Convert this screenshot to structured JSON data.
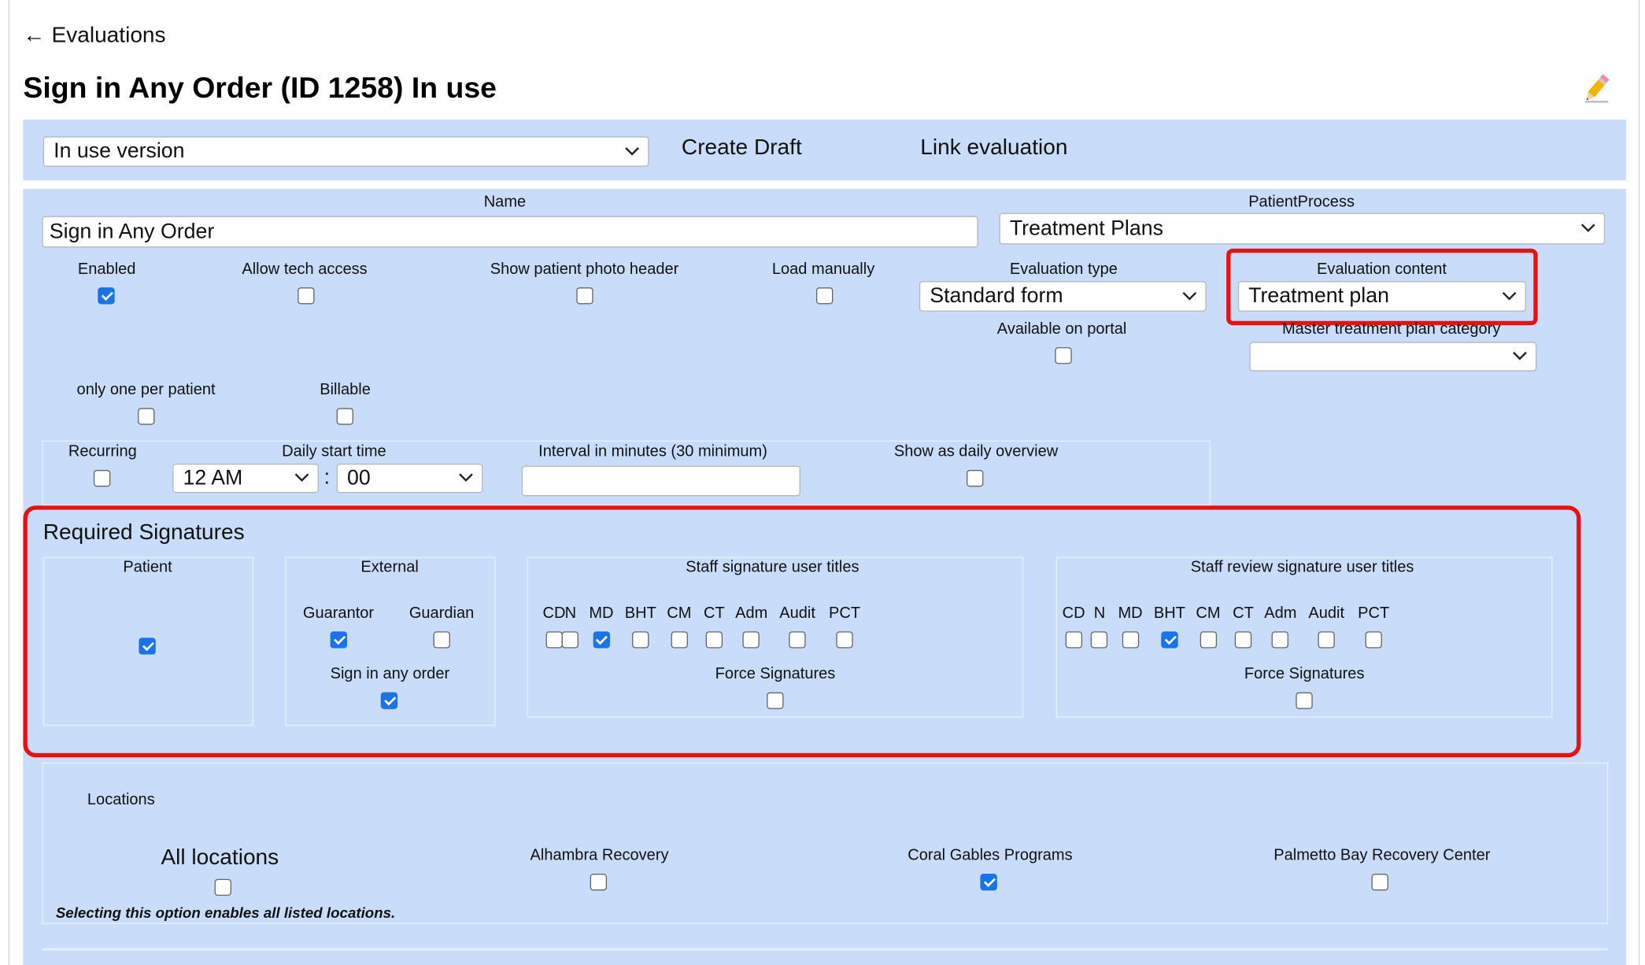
{
  "nav": {
    "back_arrow": "←",
    "back_label": "Evaluations"
  },
  "page": {
    "title": "Sign in Any Order (ID 1258) In use"
  },
  "topbar": {
    "version_select": "In use version",
    "create_draft": "Create Draft",
    "link_evaluation": "Link evaluation"
  },
  "fields": {
    "name_label": "Name",
    "name_value": "Sign in Any Order",
    "patient_process_label": "PatientProcess",
    "patient_process_value": "Treatment Plans",
    "enabled_label": "Enabled",
    "allow_tech_label": "Allow tech access",
    "photo_header_label": "Show patient photo header",
    "load_manually_label": "Load manually",
    "eval_type_label": "Evaluation type",
    "eval_type_value": "Standard form",
    "eval_content_label": "Evaluation content",
    "eval_content_value": "Treatment plan",
    "portal_label": "Available on portal",
    "master_category_label": "Master treatment plan category",
    "master_category_value": "",
    "one_per_patient_label": "only one per patient",
    "billable_label": "Billable"
  },
  "recurring": {
    "recurring_label": "Recurring",
    "daily_start_label": "Daily start time",
    "hour_value": "12 AM",
    "colon": ":",
    "minute_value": "00",
    "interval_label": "Interval in minutes (30 minimum)",
    "interval_value": "",
    "daily_overview_label": "Show as daily overview"
  },
  "signatures": {
    "title": "Required Signatures",
    "patient_label": "Patient",
    "external_label": "External",
    "guarantor_label": "Guarantor",
    "guardian_label": "Guardian",
    "sign_any_order_label": "Sign in any order",
    "staff_titles_label": "Staff signature user titles",
    "staff_review_label": "Staff review signature user titles",
    "force_label": "Force Signatures",
    "titles": [
      "CD",
      "N",
      "MD",
      "BHT",
      "CM",
      "CT",
      "Adm",
      "Audit",
      "PCT"
    ],
    "staff_checked": "MD",
    "review_checked": "BHT"
  },
  "locations": {
    "title": "Locations",
    "all_label": "All locations",
    "all_note": "Selecting this option enables all listed locations.",
    "alhambra": "Alhambra Recovery",
    "coral": "Coral Gables Programs",
    "palmetto": "Palmetto Bay Recovery Center"
  },
  "icons": [
    "left-arrow-icon",
    "pencil-icon",
    "chevron-down-icon",
    "checkbox-icon"
  ],
  "colors": {
    "panel": "#c9ddfb",
    "checkbox_on": "#1a73e8",
    "highlight": "#e81010"
  }
}
